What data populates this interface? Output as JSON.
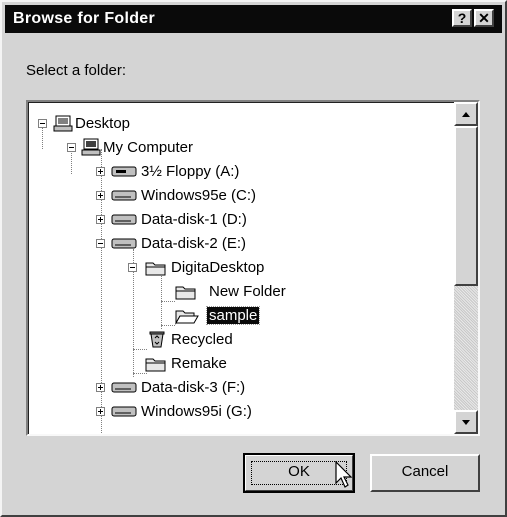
{
  "window": {
    "title": "Browse for Folder",
    "help_glyph": "?",
    "close_glyph": "✕"
  },
  "prompt": "Select a folder:",
  "tree": {
    "items": [
      {
        "label": "Desktop",
        "icon": "desktop-icon",
        "expander": "minus"
      },
      {
        "label": "My Computer",
        "icon": "my-computer-icon",
        "expander": "minus"
      },
      {
        "label": "3½ Floppy (A:)",
        "icon": "floppy-drive-icon",
        "expander": "plus"
      },
      {
        "label": "Windows95e (C:)",
        "icon": "hard-drive-icon",
        "expander": "plus"
      },
      {
        "label": "Data-disk-1 (D:)",
        "icon": "hard-drive-icon",
        "expander": "plus"
      },
      {
        "label": "Data-disk-2 (E:)",
        "icon": "hard-drive-icon",
        "expander": "minus"
      },
      {
        "label": "DigitaDesktop",
        "icon": "folder-icon",
        "expander": "minus"
      },
      {
        "label": "New Folder",
        "icon": "folder-icon",
        "expander": "none"
      },
      {
        "label": "sample",
        "icon": "open-folder-icon",
        "expander": "none",
        "selected": true
      },
      {
        "label": "Recycled",
        "icon": "recycle-bin-icon",
        "expander": "none"
      },
      {
        "label": "Remake",
        "icon": "folder-icon",
        "expander": "none"
      },
      {
        "label": "Data-disk-3 (F:)",
        "icon": "hard-drive-icon",
        "expander": "plus"
      },
      {
        "label": "Windows95i (G:)",
        "icon": "hard-drive-icon",
        "expander": "plus"
      }
    ]
  },
  "buttons": {
    "ok": "OK",
    "cancel": "Cancel"
  },
  "colors": {
    "dialog_face": "#d4d4d4",
    "titlebar": "#0a0a0a",
    "selection": "#0a0a0a"
  }
}
